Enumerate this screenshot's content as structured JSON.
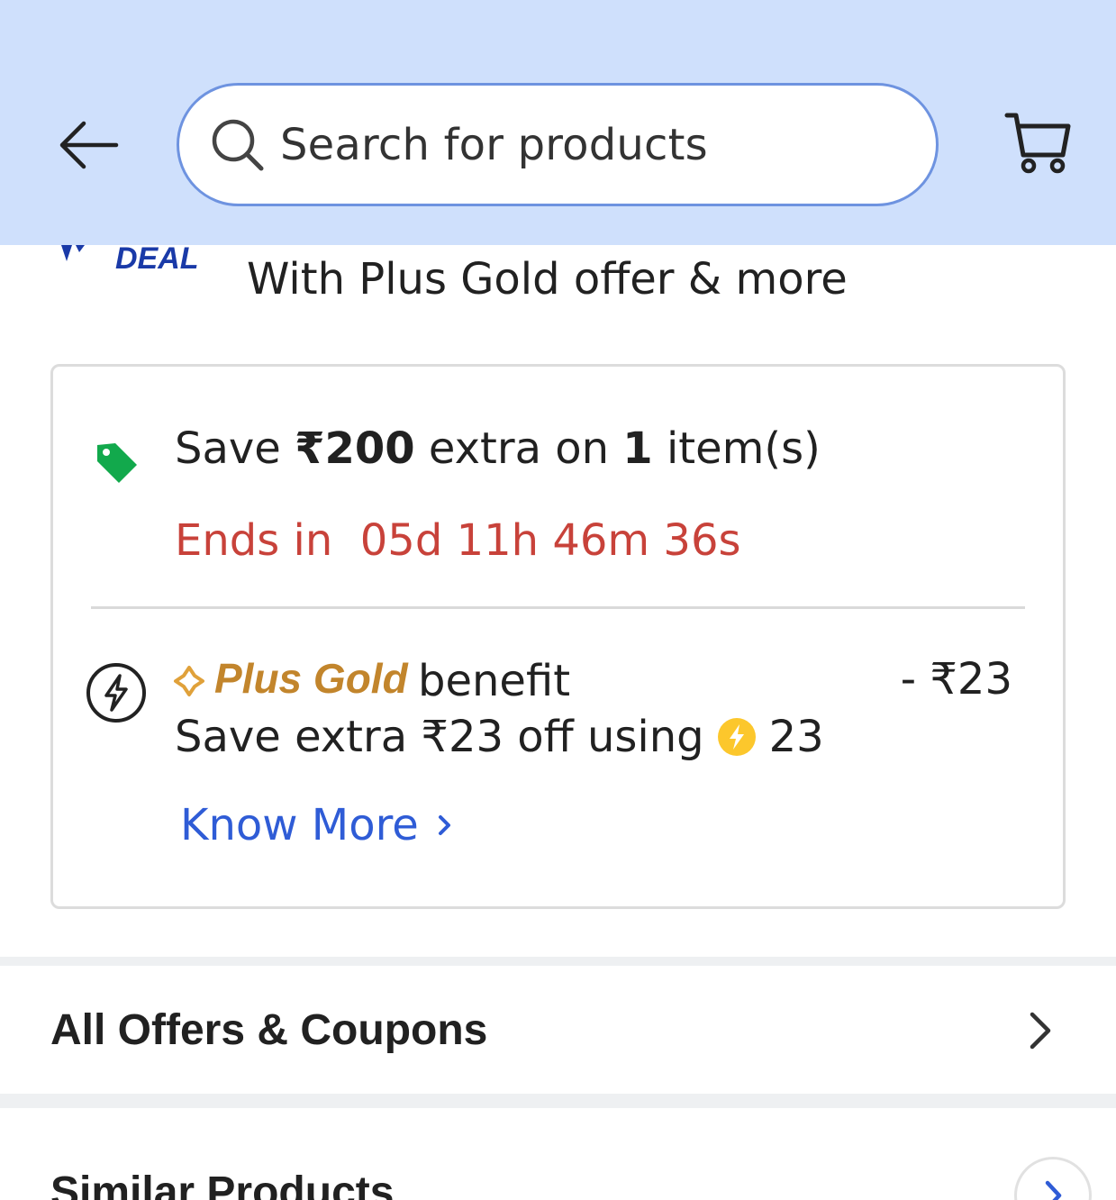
{
  "header": {
    "search_placeholder": "Search for products",
    "back_icon": "arrow-left-icon",
    "search_icon": "magnifier-icon",
    "cart_icon": "shopping-cart-icon"
  },
  "deal": {
    "badge_text": "DEAL",
    "subtitle": "With Plus Gold offer & more"
  },
  "offer": {
    "save_prefix": "Save ",
    "save_amount": "₹200",
    "save_middle": " extra on ",
    "save_count": "1",
    "save_suffix": " item(s)",
    "ends_in": "Ends in  05d 11h 46m 36s"
  },
  "plus_gold": {
    "brand_label": "Plus Gold",
    "benefit_label": "benefit",
    "benefit_amount": "- ₹23",
    "save_extra_text": "Save extra ₹23 off using",
    "coin_value": "23",
    "know_more": "Know More"
  },
  "sections": {
    "all_offers": "All Offers & Coupons",
    "similar_products": "Similar Products"
  },
  "colors": {
    "header_bg": "#cfe0fc",
    "timer_red": "#c8423a",
    "link_blue": "#2f5cd6",
    "plus_gold": "#c2852c",
    "tag_green": "#12a94c",
    "coin_yellow": "#fcc72c"
  }
}
